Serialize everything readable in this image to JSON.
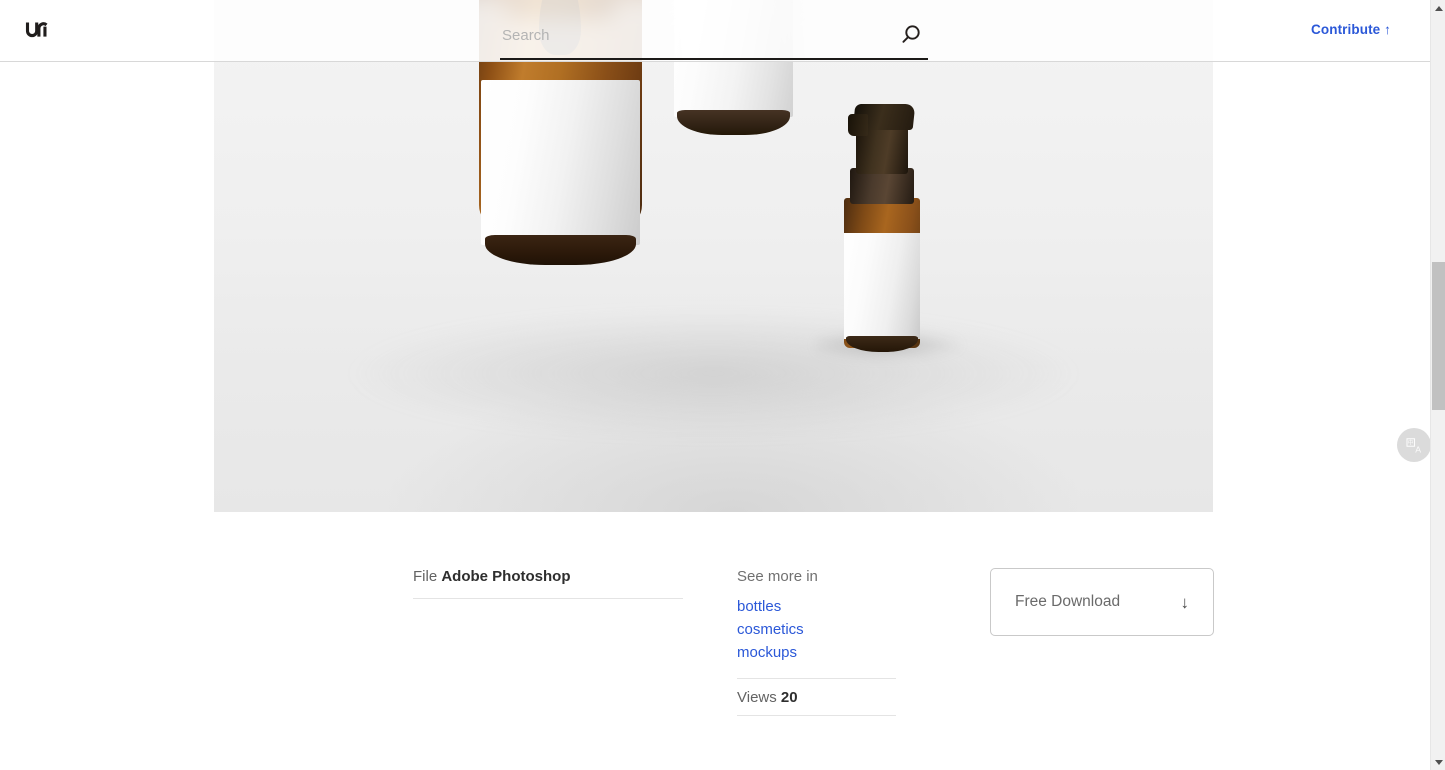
{
  "header": {
    "logo_name": "unsplash-logo",
    "search": {
      "placeholder": "Search",
      "value": "",
      "icon": "search-icon"
    },
    "contribute_label": "Contribute ↑"
  },
  "photo": {
    "alt": "three amber glass cosmetic bottles with blank white labels on a light gray background",
    "background_color": "#ececec"
  },
  "meta": {
    "file": {
      "label": "File",
      "value": "Adobe Photoshop"
    },
    "see_more": {
      "title": "See more in",
      "tags": [
        "bottles",
        "cosmetics",
        "mockups"
      ]
    },
    "views": {
      "label": "Views",
      "value": "20"
    }
  },
  "download": {
    "label": "Free Download",
    "arrow": "↓"
  },
  "floating": {
    "translate_icon": "translate-icon"
  },
  "colors": {
    "link_blue": "#2b58d8",
    "text_dark": "#2e2e2e",
    "text_muted": "#636363",
    "rule": "#e4e4e4",
    "scrollbar_thumb": "#c1c1c1"
  },
  "scrollbar": {
    "up_arrow": "▲",
    "down_arrow": "▼"
  }
}
